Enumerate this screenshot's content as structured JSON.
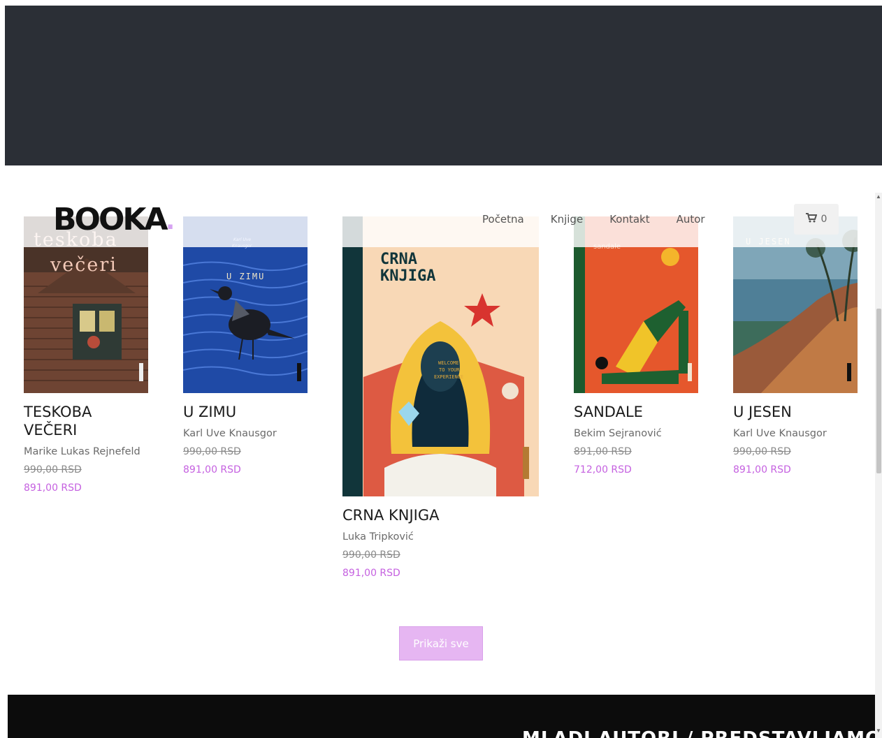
{
  "header": {
    "logo": "BOOKA",
    "nav": [
      "Početna",
      "Knjige",
      "Kontakt",
      "Autor"
    ],
    "cart_count": "0"
  },
  "products": [
    {
      "title": "TESKOBA VEČERI",
      "author": "Marike Lukas Rejnefeld",
      "old_price": "990,00 RSD",
      "new_price": "891,00 RSD",
      "cover_text": "teskoba večeri"
    },
    {
      "title": "U ZIMU",
      "author": "Karl Uve Knausgor",
      "old_price": "990,00 RSD",
      "new_price": "891,00 RSD",
      "cover_text": "U ZIMU",
      "cover_small": "Karl Uve Knausgor"
    },
    {
      "title": "CRNA KNJIGA",
      "author": "Luka Tripković",
      "old_price": "990,00 RSD",
      "new_price": "891,00 RSD",
      "cover_text": "CRNA KNJIGA",
      "cover_small": "WELCOME TO YOUR EXPERIENCE"
    },
    {
      "title": "SANDALE",
      "author": "Bekim Sejranović",
      "old_price": "891,00 RSD",
      "new_price": "712,00 RSD",
      "cover_text": "sandale"
    },
    {
      "title": "U JESEN",
      "author": "Karl Uve Knausgor",
      "old_price": "990,00 RSD",
      "new_price": "891,00 RSD",
      "cover_text": "U JESEN"
    }
  ],
  "show_all_label": "Prikaži sve",
  "bottom_section_title": "MLADI AUTORI / PREDSTAVLJAMO",
  "colors": {
    "accent": "#c561e0",
    "button_bg": "#e6b6f2",
    "dark_band": "#2b2f36"
  }
}
